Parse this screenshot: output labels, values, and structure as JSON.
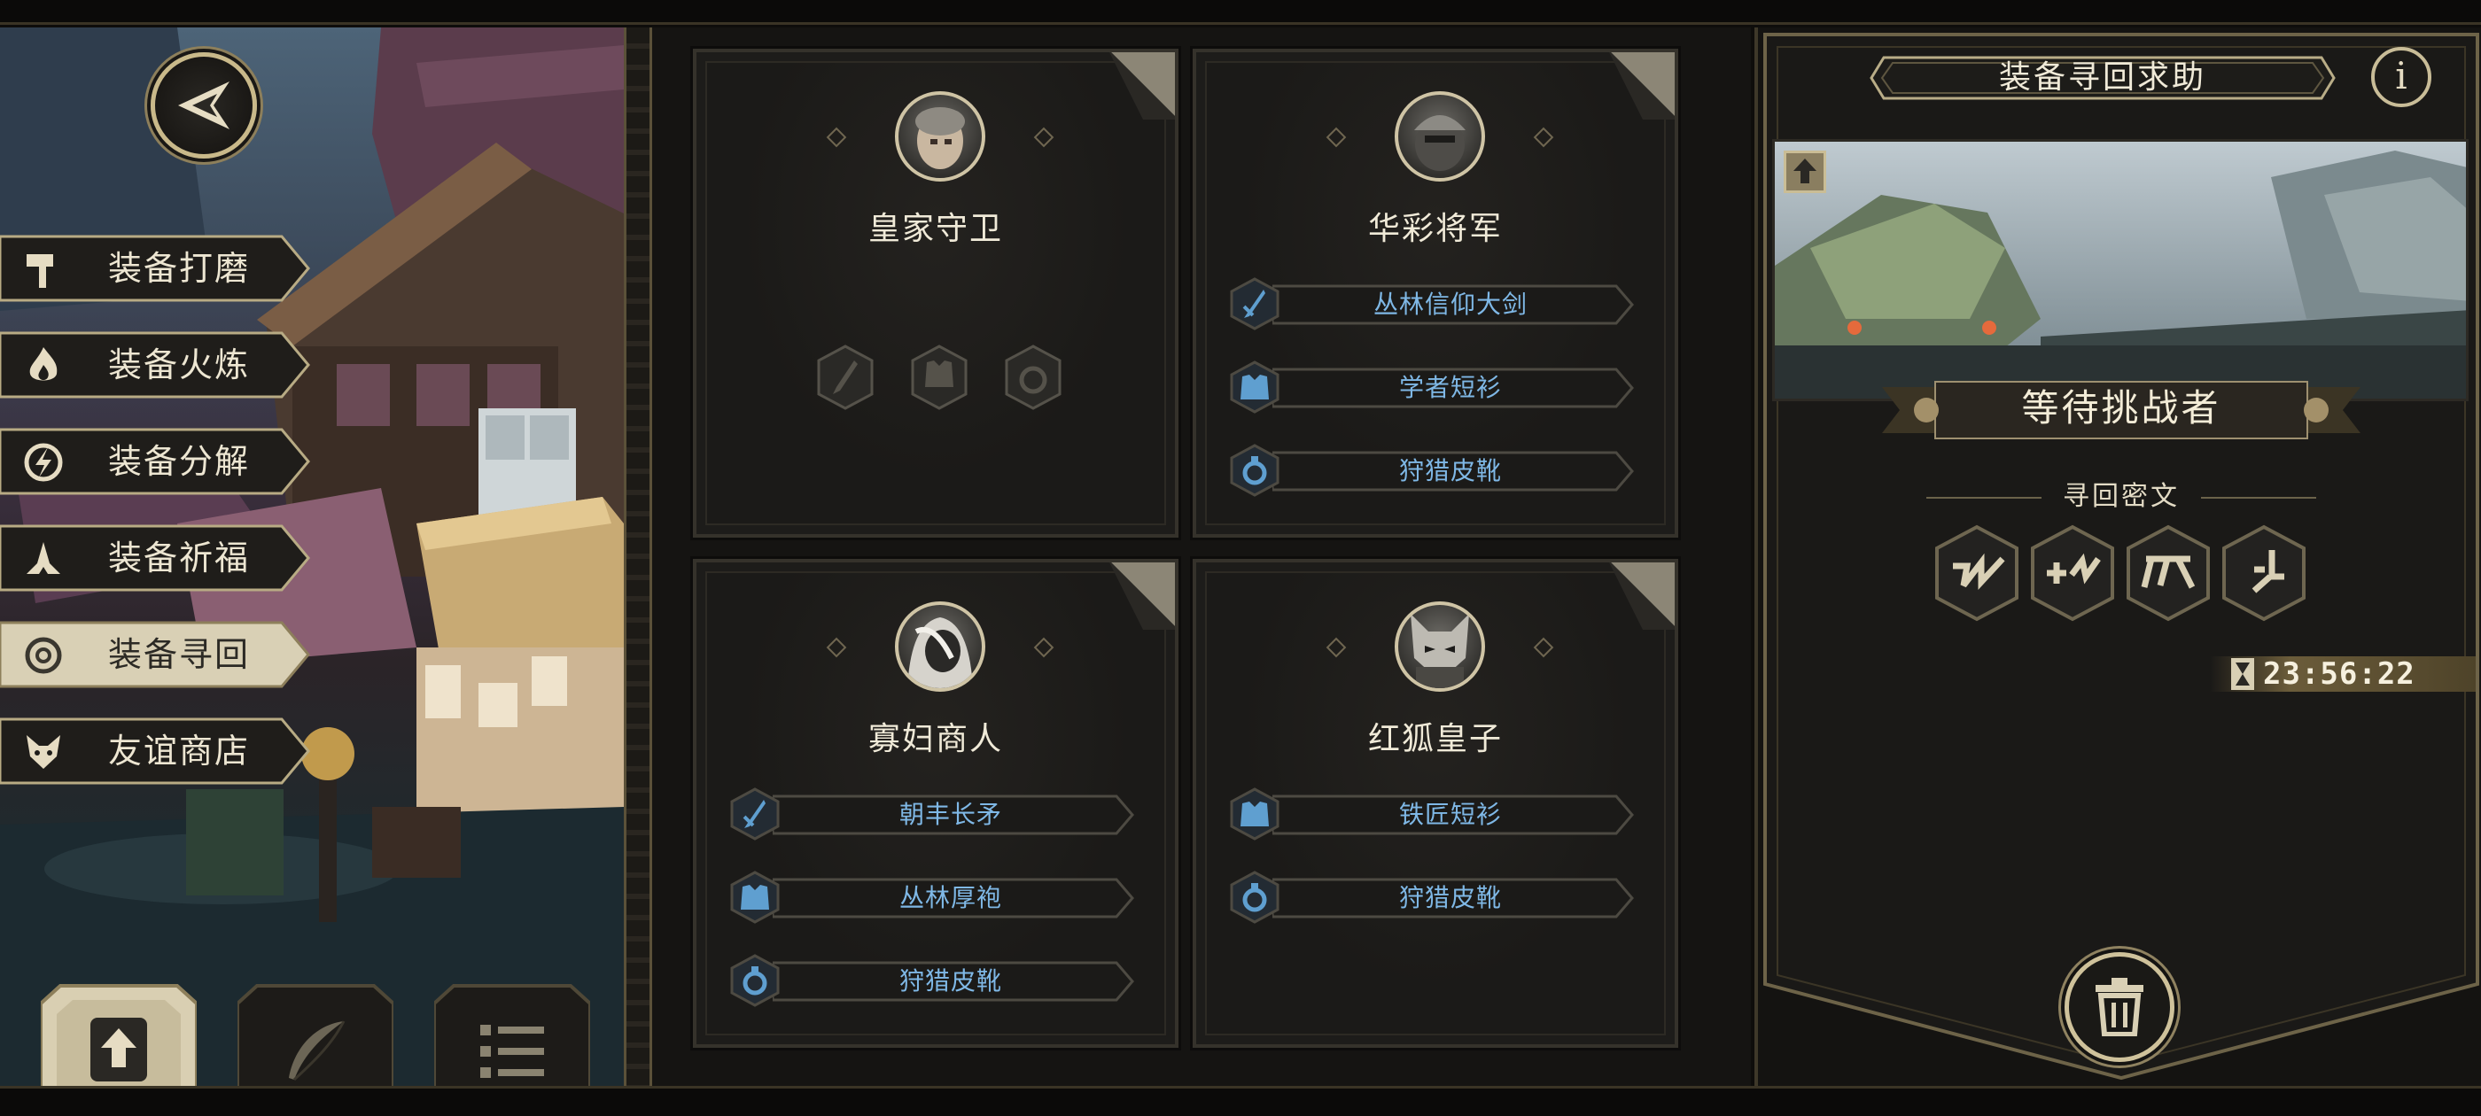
{
  "side_menu": {
    "items": [
      {
        "label": "装备打磨",
        "icon": "hammer-icon",
        "active": false
      },
      {
        "label": "装备火炼",
        "icon": "flame-icon",
        "active": false
      },
      {
        "label": "装备分解",
        "icon": "disassemble-icon",
        "active": false
      },
      {
        "label": "装备祈福",
        "icon": "pray-hands-icon",
        "active": false
      },
      {
        "label": "装备寻回",
        "icon": "target-icon",
        "active": true
      },
      {
        "label": "友谊商店",
        "icon": "fox-icon",
        "active": false
      }
    ]
  },
  "bottom_buttons": [
    {
      "icon": "upload-icon",
      "active": true
    },
    {
      "icon": "feather-icon",
      "active": false
    },
    {
      "icon": "list-icon",
      "active": false
    }
  ],
  "cards": [
    {
      "name": "皇家守卫",
      "portrait": "royal-guard-portrait",
      "items": [],
      "empty_slots": [
        "sword-icon",
        "armor-icon",
        "ring-icon"
      ]
    },
    {
      "name": "华彩将军",
      "portrait": "general-portrait",
      "items": [
        {
          "label": "丛林信仰大剑",
          "icon": "sword-icon"
        },
        {
          "label": "学者短衫",
          "icon": "armor-icon"
        },
        {
          "label": "狩猎皮靴",
          "icon": "ring-icon"
        }
      ]
    },
    {
      "name": "寡妇商人",
      "portrait": "widow-merchant-portrait",
      "items": [
        {
          "label": "朝丰长矛",
          "icon": "sword-icon"
        },
        {
          "label": "丛林厚袍",
          "icon": "armor-icon"
        },
        {
          "label": "狩猎皮靴",
          "icon": "ring-icon"
        }
      ]
    },
    {
      "name": "红狐皇子",
      "portrait": "fox-prince-portrait",
      "items": [
        {
          "label": "铁匠短衫",
          "icon": "armor-icon"
        },
        {
          "label": "狩猎皮靴",
          "icon": "ring-icon"
        }
      ]
    }
  ],
  "right_panel": {
    "title": "装备寻回求助",
    "info_label": "i",
    "status": "等待挑战者",
    "cipher_title": "寻回密文",
    "runes": [
      "rune-1-icon",
      "rune-2-icon",
      "rune-3-icon",
      "rune-4-icon"
    ],
    "timer": "23:56:22",
    "timer_icon": "hourglass-icon",
    "trash_icon": "trash-icon"
  },
  "colors": {
    "gold": "#cfc29b",
    "item_text": "#7fb8e6",
    "item_icon": "#5f9fd0",
    "panel_bg": "#1d1c1a"
  }
}
